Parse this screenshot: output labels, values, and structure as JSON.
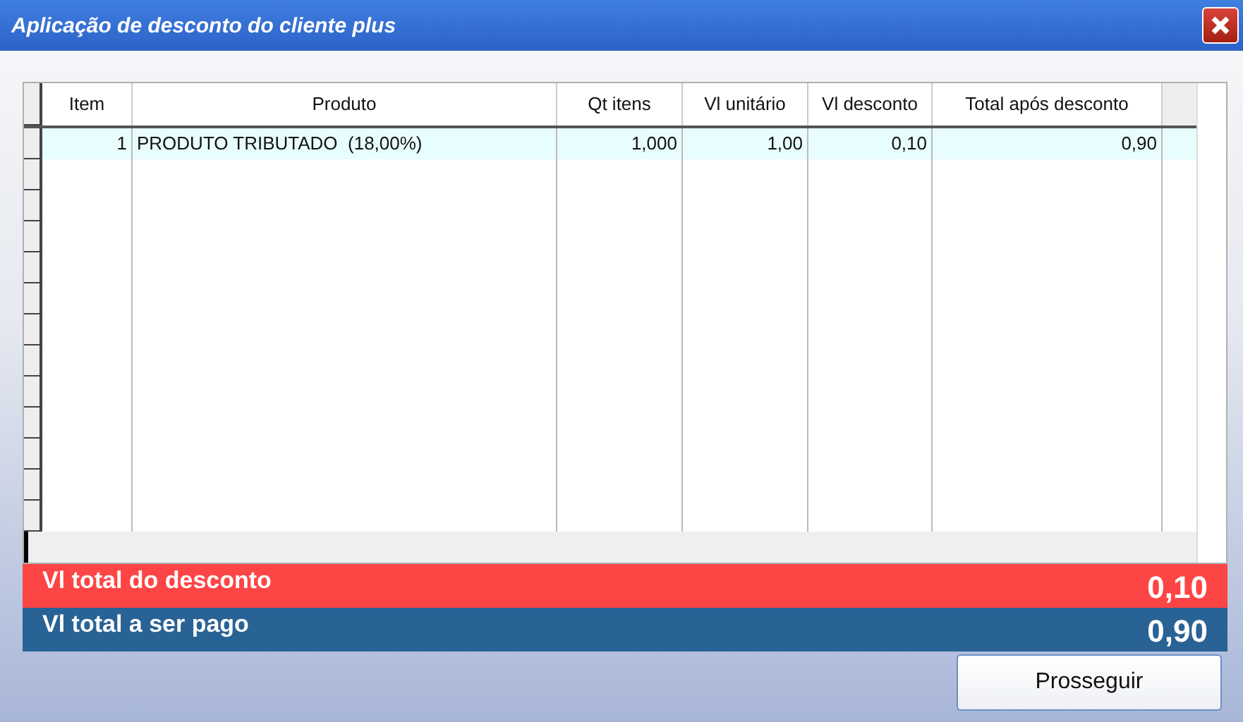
{
  "window": {
    "title": "Aplicação de desconto do cliente plus"
  },
  "table": {
    "columns": [
      "Item",
      "Produto",
      "Qt itens",
      "Vl unitário",
      "Vl desconto",
      "Total após desconto"
    ],
    "rows": [
      {
        "cells": [
          "1",
          "PRODUTO TRIBUTADO  (18,00%)",
          "1,000",
          "1,00",
          "0,10",
          "0,90"
        ],
        "selected": true
      }
    ]
  },
  "totals": [
    {
      "kind": "discount",
      "label": "Vl total do desconto",
      "value": "0,10"
    },
    {
      "kind": "payable",
      "label": "Vl total a ser pago",
      "value": "0,90"
    }
  ],
  "buttons": [
    "Prosseguir"
  ]
}
